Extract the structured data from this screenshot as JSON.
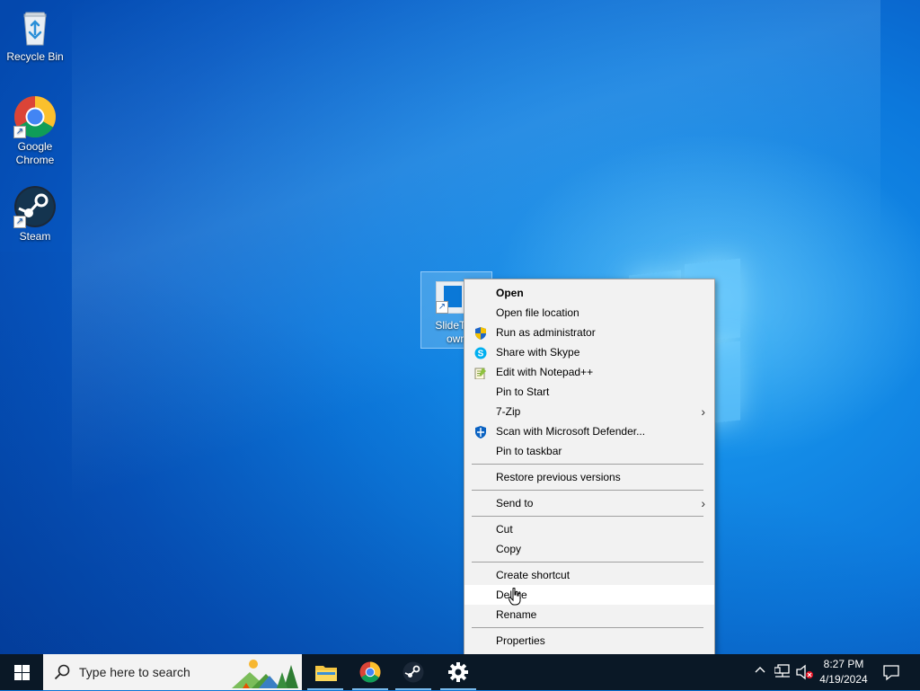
{
  "desktop": {
    "icons": [
      {
        "label": "Recycle Bin"
      },
      {
        "label": "Google Chrome"
      },
      {
        "label": "Steam"
      }
    ],
    "selected_icon": {
      "label_line1": "SlideToS",
      "label_line2": "own"
    }
  },
  "context_menu": {
    "items": [
      {
        "label": "Open",
        "bold": true
      },
      {
        "label": "Open file location"
      },
      {
        "label": "Run as administrator",
        "icon": "shield-icon"
      },
      {
        "label": "Share with Skype",
        "icon": "skype-icon"
      },
      {
        "label": "Edit with Notepad++",
        "icon": "notepad-plus-plus-icon"
      },
      {
        "label": "Pin to Start"
      },
      {
        "label": "7-Zip",
        "submenu": true
      },
      {
        "label": "Scan with Microsoft Defender...",
        "icon": "defender-icon"
      },
      {
        "label": "Pin to taskbar"
      },
      {
        "label": "Restore previous versions"
      },
      {
        "label": "Send to",
        "submenu": true
      },
      {
        "label": "Cut"
      },
      {
        "label": "Copy"
      },
      {
        "label": "Create shortcut"
      },
      {
        "label": "Delete",
        "highlighted": true
      },
      {
        "label": "Rename"
      },
      {
        "label": "Properties"
      }
    ],
    "submenu_arrow": "›"
  },
  "taskbar": {
    "search_placeholder": "Type here to search",
    "apps": [
      "file-explorer-icon",
      "chrome-icon",
      "steam-icon",
      "settings-icon"
    ],
    "clock": {
      "time": "8:27 PM",
      "date": "4/19/2024"
    },
    "tray_icons": [
      "chevron-up-icon",
      "network-icon",
      "volume-muted-icon",
      "notifications-icon"
    ]
  }
}
